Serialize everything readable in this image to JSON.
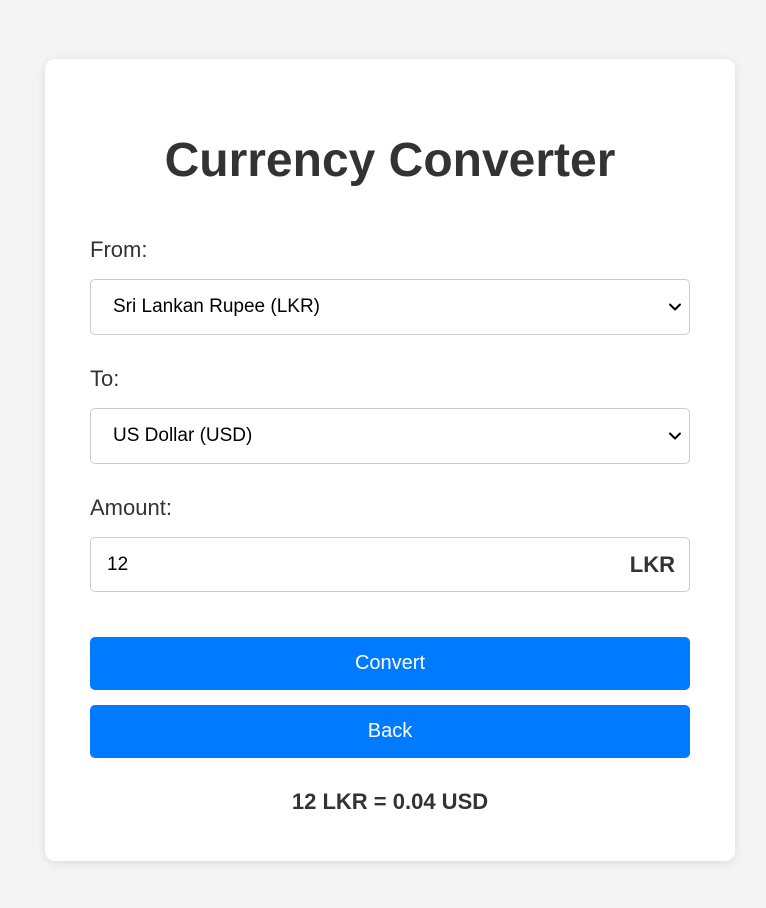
{
  "title": "Currency Converter",
  "from": {
    "label": "From:",
    "selected": "Sri Lankan Rupee (LKR)"
  },
  "to": {
    "label": "To:",
    "selected": "US Dollar (USD)"
  },
  "amount": {
    "label": "Amount:",
    "value": "12",
    "currency_code": "LKR"
  },
  "buttons": {
    "convert": "Convert",
    "back": "Back"
  },
  "result": "12 LKR = 0.04 USD",
  "colors": {
    "primary": "#007bff",
    "text": "#333333",
    "background": "#f4f4f4"
  },
  "icons": {
    "select_arrow": "chevron-down-icon"
  }
}
